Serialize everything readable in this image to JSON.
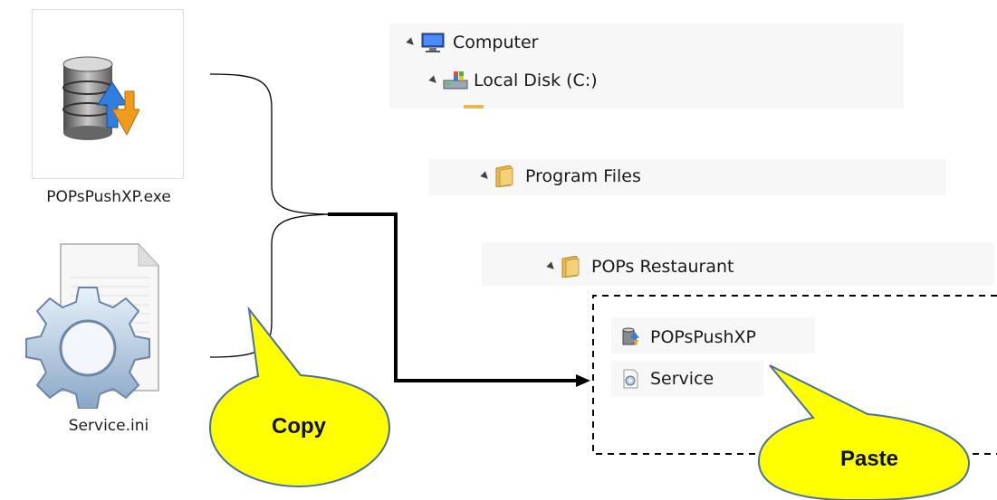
{
  "files": {
    "exe_label": "POPsPushXP.exe",
    "ini_label": "Service.ini"
  },
  "tree": {
    "computer": "Computer",
    "local_disk": "Local Disk (C:)",
    "program_files": "Program Files",
    "pops_restaurant": "POPs Restaurant",
    "pops_push": "POPsPushXP",
    "service": "Service"
  },
  "callouts": {
    "copy": "Copy",
    "paste": "Paste"
  },
  "colors": {
    "bubble_fill": "#ffff00",
    "bubble_stroke": "#4a6fa5",
    "arrow": "#000000",
    "folder": "#e8b84a"
  }
}
